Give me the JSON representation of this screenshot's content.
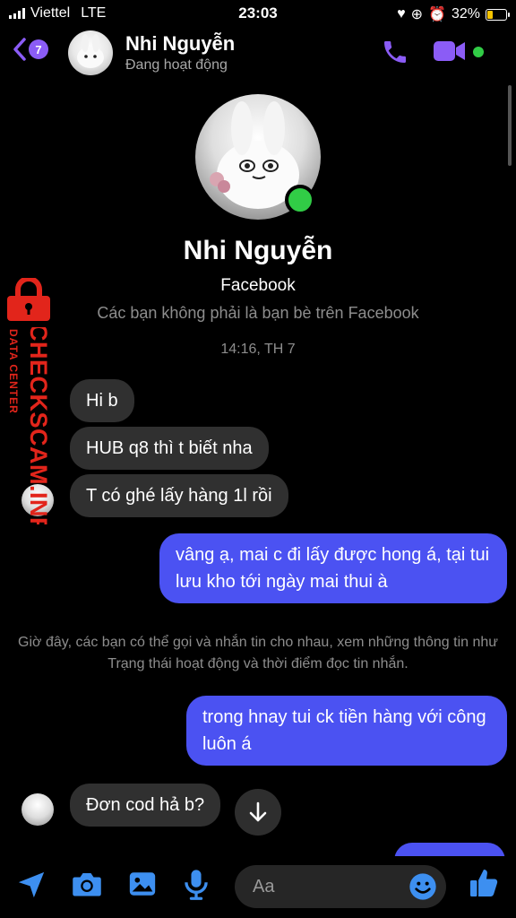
{
  "status_bar": {
    "carrier": "Viettel",
    "network": "LTE",
    "time": "23:03",
    "battery": "32%"
  },
  "header": {
    "back_badge": "7",
    "name": "Nhi Nguyễn",
    "status": "Đang hoạt động"
  },
  "profile": {
    "name": "Nhi Nguyễn",
    "platform": "Facebook",
    "note": "Các bạn không phải là bạn bè trên Facebook"
  },
  "timestamp": "14:16, TH 7",
  "messages": [
    {
      "from": "them",
      "text": "Hi b"
    },
    {
      "from": "them",
      "text": "HUB q8 thì t biết nha"
    },
    {
      "from": "them",
      "text": "T có ghé lấy hàng 1l rồi"
    },
    {
      "from": "me",
      "text": "vâng ạ, mai c đi lấy được hong á, tại tui lưu kho tới ngày mai thui à"
    },
    {
      "from": "me",
      "text": "trong hnay tui ck tiền hàng với công luôn á"
    },
    {
      "from": "them",
      "text": "Đơn cod hả b?"
    }
  ],
  "system_note": "Giờ đây, các bạn có thể gọi và nhắn tin cho nhau, xem những thông tin như Trạng thái hoạt động và thời điểm đọc tin nhắn.",
  "composer": {
    "placeholder": "Aa"
  },
  "watermark": {
    "brand": "CHECKSCAM.INFO",
    "tag": "DATA CENTER"
  },
  "colors": {
    "accent": "#8b5cf6",
    "outgoing_bubble": "#4b52f2",
    "incoming_bubble": "#303030",
    "online": "#31cc46",
    "composer_icons": "#3d8ff0"
  },
  "icons": [
    "back-chevron-icon",
    "phone-icon",
    "video-camera-icon",
    "location-arrow-icon",
    "camera-icon",
    "image-icon",
    "microphone-icon",
    "emoji-icon",
    "thumbs-up-icon",
    "arrow-down-icon",
    "lock-icon"
  ]
}
